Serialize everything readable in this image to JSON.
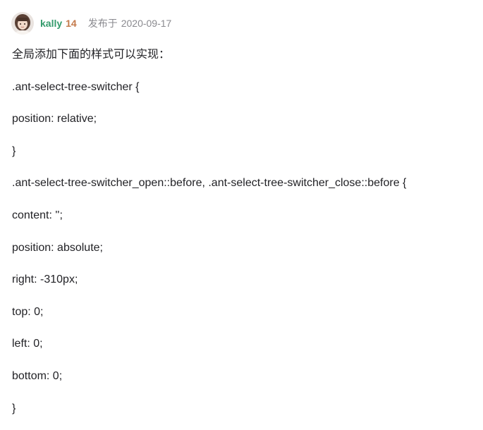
{
  "author": {
    "name": "kally",
    "level": "14",
    "avatar_icon": "user-avatar",
    "name_color": "#349b6c",
    "level_color": "#c47a4b"
  },
  "meta": {
    "published_prefix": "发布于",
    "published_date": "2020-09-17"
  },
  "content": {
    "lines": [
      "全局添加下面的样式可以实现：",
      ".ant-select-tree-switcher {",
      "position: relative;",
      "}",
      ".ant-select-tree-switcher_open::before, .ant-select-tree-switcher_close::before {",
      "content: '';",
      "position: absolute;",
      "right: -310px;",
      "top: 0;",
      "left: 0;",
      "bottom: 0;",
      "}"
    ]
  }
}
